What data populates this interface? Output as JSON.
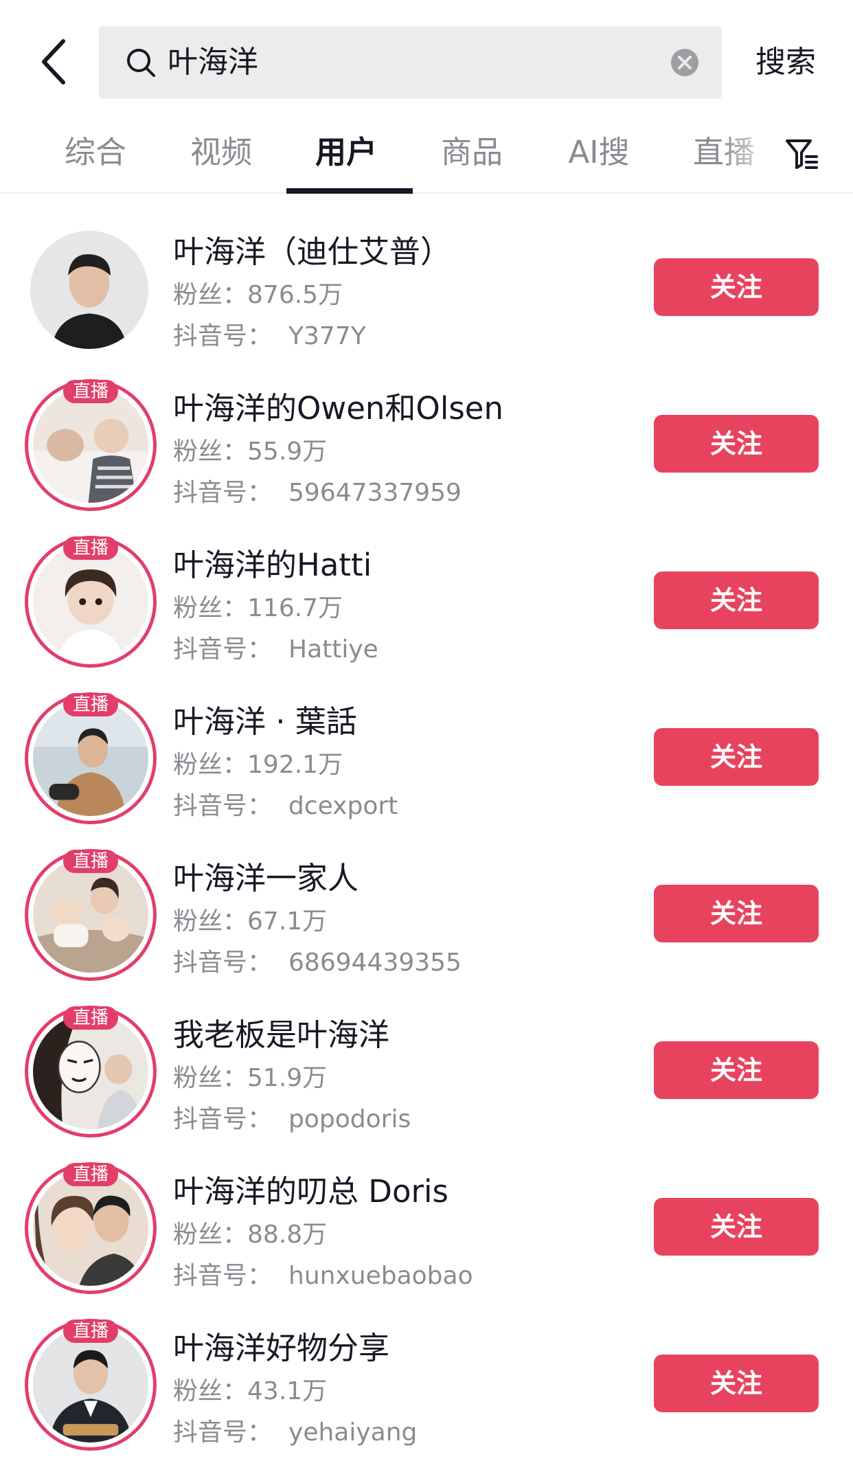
{
  "search": {
    "query": "叶海洋",
    "submit_label": "搜索"
  },
  "tabs": [
    {
      "label": "综合",
      "active": false
    },
    {
      "label": "视频",
      "active": false
    },
    {
      "label": "用户",
      "active": true
    },
    {
      "label": "商品",
      "active": false
    },
    {
      "label": "AI搜",
      "active": false
    },
    {
      "label": "直播",
      "active": false
    }
  ],
  "colors": {
    "accent": "#e8435e",
    "live_ring": "#e23e6a",
    "secondary_text": "#8a8b91"
  },
  "icons": {
    "back": "chevron-left-icon",
    "search": "search-icon",
    "clear": "clear-icon",
    "filter": "filter-icon"
  },
  "users": [
    {
      "name": "叶海洋（迪仕艾普）",
      "fans_label": "粉丝：",
      "fans": "876.5万",
      "id_label": "抖音号：",
      "id": "Y377Y",
      "live": false,
      "live_label": "",
      "follow_label": "关注"
    },
    {
      "name": "叶海洋的Owen和Olsen",
      "fans_label": "粉丝：",
      "fans": "55.9万",
      "id_label": "抖音号：",
      "id": "59647337959",
      "live": true,
      "live_label": "直播",
      "follow_label": "关注"
    },
    {
      "name": "叶海洋的Hatti",
      "fans_label": "粉丝：",
      "fans": "116.7万",
      "id_label": "抖音号：",
      "id": "Hattiye",
      "live": true,
      "live_label": "直播",
      "follow_label": "关注"
    },
    {
      "name": "叶海洋 · 葉話",
      "fans_label": "粉丝：",
      "fans": "192.1万",
      "id_label": "抖音号：",
      "id": "dcexport",
      "live": true,
      "live_label": "直播",
      "follow_label": "关注"
    },
    {
      "name": "叶海洋一家人",
      "fans_label": "粉丝：",
      "fans": "67.1万",
      "id_label": "抖音号：",
      "id": "68694439355",
      "live": true,
      "live_label": "直播",
      "follow_label": "关注"
    },
    {
      "name": "我老板是叶海洋",
      "fans_label": "粉丝：",
      "fans": "51.9万",
      "id_label": "抖音号：",
      "id": "popodoris",
      "live": true,
      "live_label": "直播",
      "follow_label": "关注"
    },
    {
      "name": "叶海洋的叨总 Doris",
      "fans_label": "粉丝：",
      "fans": "88.8万",
      "id_label": "抖音号：",
      "id": "hunxuebaobao",
      "live": true,
      "live_label": "直播",
      "follow_label": "关注"
    },
    {
      "name": "叶海洋好物分享",
      "fans_label": "粉丝：",
      "fans": "43.1万",
      "id_label": "抖音号：",
      "id": "yehaiyang",
      "live": true,
      "live_label": "直播",
      "follow_label": "关注"
    }
  ]
}
